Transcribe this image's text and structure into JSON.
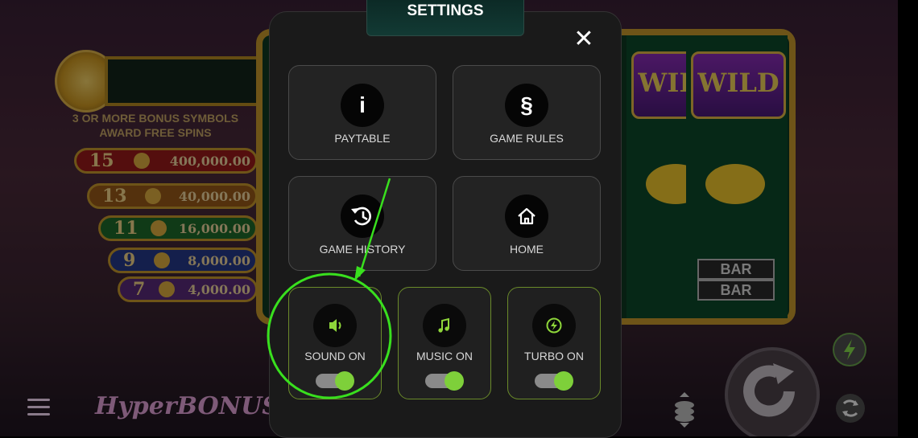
{
  "game": {
    "bonus_title_line1": "3 OR MORE BONUS SYMBOLS",
    "bonus_title_line2": "AWARD FREE SPINS",
    "paytable_rows": [
      {
        "count": "15",
        "amount": "400,000.00",
        "color": "#9a1a1a"
      },
      {
        "count": "13",
        "amount": "40,000.00",
        "color": "#9a5a18"
      },
      {
        "count": "11",
        "amount": "16,000.00",
        "color": "#1e6b2a"
      },
      {
        "count": "9",
        "amount": "8,000.00",
        "color": "#263a8a"
      },
      {
        "count": "7",
        "amount": "4,000.00",
        "color": "#5a2a7a"
      }
    ],
    "reel_wild_label": "WILD",
    "reel_bar_label": "BAR",
    "logo_text": "HyperBONUS"
  },
  "settings": {
    "title": "SETTINGS",
    "close_icon": "close-icon",
    "tiles": {
      "paytable": {
        "label": "PAYTABLE",
        "icon_glyph": "i"
      },
      "game_rules": {
        "label": "GAME RULES",
        "icon_glyph": "§"
      },
      "game_history": {
        "label": "GAME HISTORY",
        "icon": "history-icon"
      },
      "home": {
        "label": "HOME",
        "icon": "home-icon"
      }
    },
    "toggles": {
      "sound": {
        "label": "SOUND ON",
        "icon": "speaker-icon",
        "on": true
      },
      "music": {
        "label": "MUSIC ON",
        "icon": "music-note-icon",
        "on": true
      },
      "turbo": {
        "label": "TURBO ON",
        "icon": "lightning-icon",
        "on": true
      }
    }
  },
  "colors": {
    "accent_green": "#7ed03a",
    "annotation_green": "#39e01e"
  }
}
